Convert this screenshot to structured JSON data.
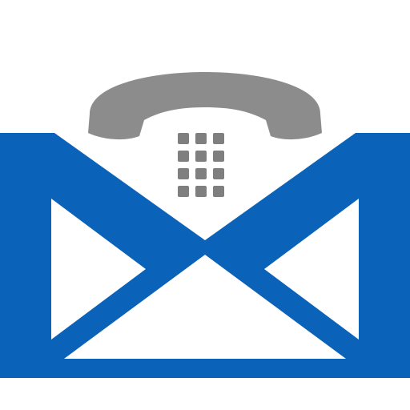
{
  "icon": {
    "name": "mail-phone-icon",
    "colors": {
      "background": "#ffffff",
      "envelope_blue": "#0a63b8",
      "envelope_white": "#ffffff",
      "handset_gray": "#8c8c8c",
      "keypad_gray": "#7f7f7f"
    }
  }
}
